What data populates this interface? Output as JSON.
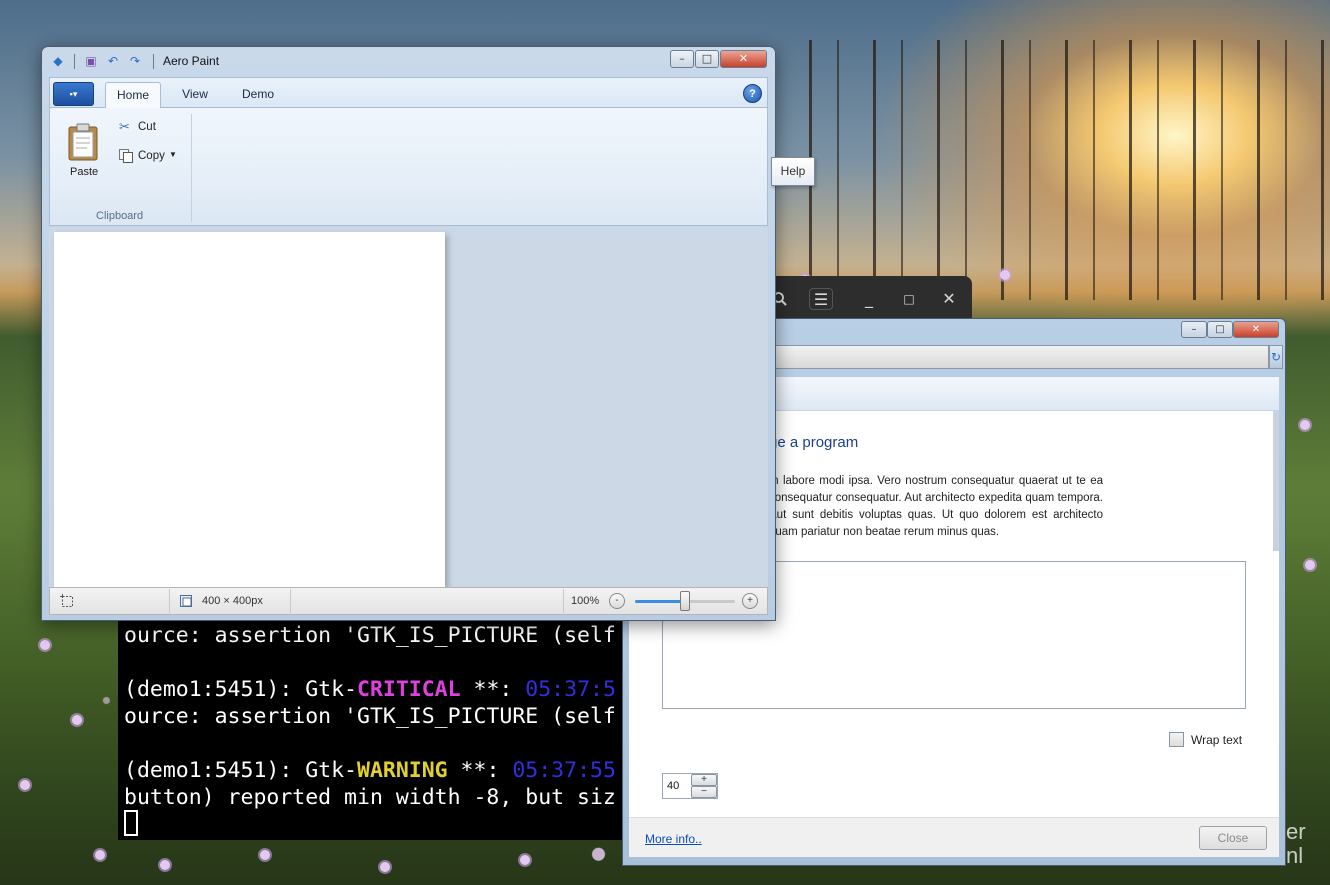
{
  "paint": {
    "title": "Aero Paint",
    "tabs": [
      {
        "label": "Home",
        "active": true
      },
      {
        "label": "View",
        "active": false
      },
      {
        "label": "Demo",
        "active": false
      }
    ],
    "help_tooltip": "Help",
    "help_glyph": "?",
    "clipboard": {
      "paste_label": "Paste",
      "cut_label": "Cut",
      "copy_label": "Copy",
      "group_label": "Clipboard"
    },
    "status": {
      "dimensions": "400 × 400px",
      "zoom_label": "100%",
      "zoom_minus": "-",
      "zoom_plus": "+",
      "zoom_level": 0.5
    }
  },
  "dialog": {
    "heading": "ge a program",
    "paragraph": "m labore modi ipsa. Vero nostrum consequatur quaerat ut te ea consequatur consequatur. Aut architecto expedita quam tempora. Aut sunt debitis voluptas quas. Ut quo dolorem est architecto quam pariatur non beatae rerum minus quas.",
    "wrap_text_label": "Wrap text",
    "wrap_text_checked": false,
    "spin_value": "40",
    "spin_up": "+",
    "spin_down": "−",
    "more_info": "More info..",
    "close_label": "Close"
  },
  "terminal": {
    "lines": [
      {
        "plain": "ource: assertion 'GTK_IS_PICTURE (self"
      },
      {
        "prefix": "(demo1:5451): Gtk-",
        "level": "CRITICAL",
        "mid": " **: ",
        "time": "05:37:5"
      },
      {
        "plain": "ource: assertion 'GTK_IS_PICTURE (self"
      },
      {
        "prefix": "(demo1:5451): Gtk-",
        "level": "WARNING",
        "mid": " **: ",
        "time": "05:37:55"
      },
      {
        "plain": "button) reported min width -8, but siz"
      }
    ]
  },
  "desktop": {
    "watermark": [
      "er",
      "nl"
    ]
  },
  "colors": {
    "critical": "#e040e0",
    "warning": "#e0d030",
    "timestamp": "#3030e0",
    "link": "#0a4fb5",
    "heading": "#1e3f8a"
  },
  "icons": [
    "app-menu-icon",
    "save-icon",
    "undo-icon",
    "redo-icon",
    "paste-icon",
    "cut-icon",
    "copy-icon",
    "help-icon",
    "selection-icon",
    "canvas-size-icon",
    "refresh-icon",
    "search-icon",
    "menu-icon"
  ]
}
